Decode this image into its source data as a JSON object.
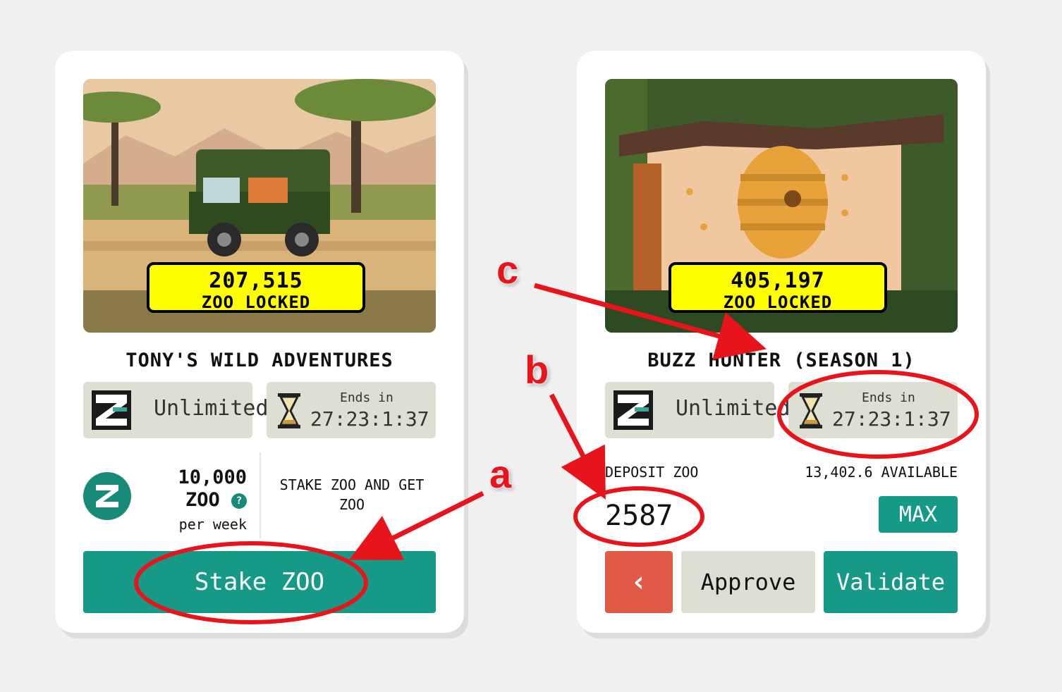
{
  "cards": {
    "left": {
      "locked_amount": "207,515",
      "locked_unit": "ZOO LOCKED",
      "title": "TONY'S WILD ADVENTURES",
      "capacity": "Unlimited",
      "ends_label": "Ends in",
      "ends_time": "27:23:1:37",
      "reward_amount": "10,000",
      "reward_unit": "ZOO",
      "reward_help": "?",
      "reward_period": "per week",
      "stake_info": "STAKE ZOO AND GET ZOO",
      "stake_button": "Stake ZOO"
    },
    "right": {
      "locked_amount": "405,197",
      "locked_unit": "ZOO LOCKED",
      "title": "BUZZ HUNTER (SEASON 1)",
      "capacity": "Unlimited",
      "ends_label": "Ends in",
      "ends_time": "27:23:1:37",
      "deposit_label": "DEPOSIT ZOO",
      "available": "13,402.6 AVAILABLE",
      "deposit_value": "2587",
      "max_button": "MAX",
      "back_button": "‹",
      "approve_button": "Approve",
      "validate_button": "Validate"
    }
  },
  "annotations": {
    "a": "a",
    "b": "b",
    "c": "c",
    "color": "#e8141c"
  },
  "colors": {
    "accent": "#169a87",
    "locked_badge": "#ffff00",
    "back_button": "#e15a45",
    "chip_bg": "#dcdfd2"
  }
}
